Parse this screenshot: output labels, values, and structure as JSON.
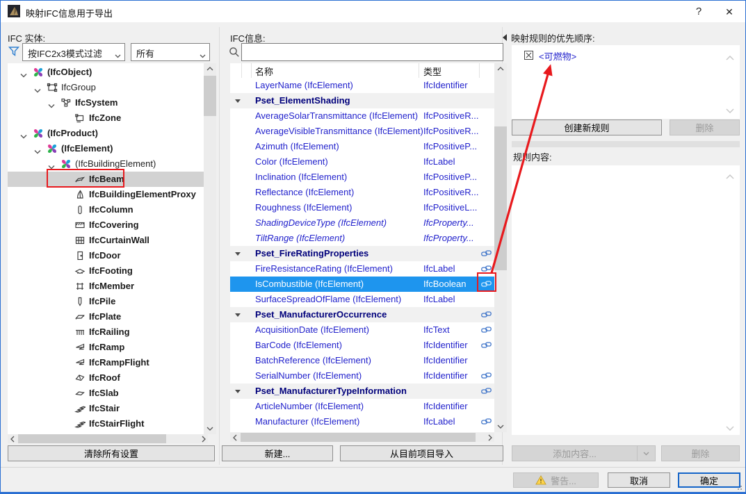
{
  "window": {
    "title": "映射IFC信息用于导出",
    "help": "?",
    "close": "✕"
  },
  "left_panel": {
    "label": "IFC 实体:",
    "filter_scheme": "按IFC2x3模式过滤",
    "filter_scope": "所有",
    "clear_button": "清除所有设置",
    "tree": [
      {
        "label": "(IfcObject)",
        "level": 0,
        "bold": true,
        "chevron": true,
        "icon": "pinwheel"
      },
      {
        "label": "IfcGroup",
        "level": 1,
        "bold": false,
        "chevron": true,
        "icon": "group"
      },
      {
        "label": "IfcSystem",
        "level": 2,
        "bold": true,
        "chevron": true,
        "icon": "system"
      },
      {
        "label": "IfcZone",
        "level": 3,
        "bold": true,
        "chevron": false,
        "icon": "zone"
      },
      {
        "label": "(IfcProduct)",
        "level": 0,
        "bold": true,
        "chevron": true,
        "icon": "pinwheel"
      },
      {
        "label": "(IfcElement)",
        "level": 1,
        "bold": true,
        "chevron": true,
        "icon": "pinwheel"
      },
      {
        "label": "(IfcBuildingElement)",
        "level": 2,
        "bold": false,
        "chevron": true,
        "icon": "pinwheel"
      },
      {
        "label": "IfcBeam",
        "level": 3,
        "bold": true,
        "chevron": false,
        "icon": "beam",
        "selected": true,
        "red_box": true
      },
      {
        "label": "IfcBuildingElementProxy",
        "level": 3,
        "bold": true,
        "chevron": false,
        "icon": "proxy"
      },
      {
        "label": "IfcColumn",
        "level": 3,
        "bold": true,
        "chevron": false,
        "icon": "column"
      },
      {
        "label": "IfcCovering",
        "level": 3,
        "bold": true,
        "chevron": false,
        "icon": "covering"
      },
      {
        "label": "IfcCurtainWall",
        "level": 3,
        "bold": true,
        "chevron": false,
        "icon": "curtainwall"
      },
      {
        "label": "IfcDoor",
        "level": 3,
        "bold": true,
        "chevron": false,
        "icon": "door"
      },
      {
        "label": "IfcFooting",
        "level": 3,
        "bold": true,
        "chevron": false,
        "icon": "footing"
      },
      {
        "label": "IfcMember",
        "level": 3,
        "bold": true,
        "chevron": false,
        "icon": "member"
      },
      {
        "label": "IfcPile",
        "level": 3,
        "bold": true,
        "chevron": false,
        "icon": "pile"
      },
      {
        "label": "IfcPlate",
        "level": 3,
        "bold": true,
        "chevron": false,
        "icon": "plate"
      },
      {
        "label": "IfcRailing",
        "level": 3,
        "bold": true,
        "chevron": false,
        "icon": "railing"
      },
      {
        "label": "IfcRamp",
        "level": 3,
        "bold": true,
        "chevron": false,
        "icon": "ramp"
      },
      {
        "label": "IfcRampFlight",
        "level": 3,
        "bold": true,
        "chevron": false,
        "icon": "ramp"
      },
      {
        "label": "IfcRoof",
        "level": 3,
        "bold": true,
        "chevron": false,
        "icon": "roof"
      },
      {
        "label": "IfcSlab",
        "level": 3,
        "bold": true,
        "chevron": false,
        "icon": "slab"
      },
      {
        "label": "IfcStair",
        "level": 3,
        "bold": true,
        "chevron": false,
        "icon": "stair"
      },
      {
        "label": "IfcStairFlight",
        "level": 3,
        "bold": true,
        "chevron": false,
        "icon": "stair"
      }
    ]
  },
  "middle_panel": {
    "label": "IFC信息:",
    "search_value": "",
    "columns": {
      "name": "名称",
      "type": "类型"
    },
    "rows": [
      {
        "kind": "property",
        "name": "LayerName (IfcElement)",
        "type": "IfcIdentifier"
      },
      {
        "kind": "group",
        "name": "Pset_ElementShading"
      },
      {
        "kind": "property",
        "name": "AverageSolarTransmittance (IfcElement)",
        "type": "IfcPositiveR..."
      },
      {
        "kind": "property",
        "name": "AverageVisibleTransmittance (IfcElement)",
        "type": "IfcPositiveR..."
      },
      {
        "kind": "property",
        "name": "Azimuth (IfcElement)",
        "type": "IfcPositiveP..."
      },
      {
        "kind": "property",
        "name": "Color (IfcElement)",
        "type": "IfcLabel"
      },
      {
        "kind": "property",
        "name": "Inclination (IfcElement)",
        "type": "IfcPositiveP..."
      },
      {
        "kind": "property",
        "name": "Reflectance (IfcElement)",
        "type": "IfcPositiveR..."
      },
      {
        "kind": "property",
        "name": "Roughness (IfcElement)",
        "type": "IfcPositiveL..."
      },
      {
        "kind": "property",
        "name": "ShadingDeviceType (IfcElement)",
        "type": "IfcProperty...",
        "italic": true
      },
      {
        "kind": "property",
        "name": "TiltRange (IfcElement)",
        "type": "IfcProperty...",
        "italic": true
      },
      {
        "kind": "group",
        "name": "Pset_FireRatingProperties",
        "link": true
      },
      {
        "kind": "property",
        "name": "FireResistanceRating (IfcElement)",
        "type": "IfcLabel",
        "link": true
      },
      {
        "kind": "property",
        "name": "IsCombustible (IfcElement)",
        "type": "IfcBoolean",
        "link": true,
        "selected": true,
        "red_box": true
      },
      {
        "kind": "property",
        "name": "SurfaceSpreadOfFlame (IfcElement)",
        "type": "IfcLabel"
      },
      {
        "kind": "group",
        "name": "Pset_ManufacturerOccurrence",
        "link": true
      },
      {
        "kind": "property",
        "name": "AcquisitionDate (IfcElement)",
        "type": "IfcText",
        "link": true
      },
      {
        "kind": "property",
        "name": "BarCode (IfcElement)",
        "type": "IfcIdentifier",
        "link": true
      },
      {
        "kind": "property",
        "name": "BatchReference (IfcElement)",
        "type": "IfcIdentifier"
      },
      {
        "kind": "property",
        "name": "SerialNumber (IfcElement)",
        "type": "IfcIdentifier",
        "link": true
      },
      {
        "kind": "group",
        "name": "Pset_ManufacturerTypeInformation",
        "link": true
      },
      {
        "kind": "property",
        "name": "ArticleNumber (IfcElement)",
        "type": "IfcIdentifier"
      },
      {
        "kind": "property",
        "name": "Manufacturer (IfcElement)",
        "type": "IfcLabel",
        "link": true
      }
    ],
    "new_button": "新建...",
    "import_button": "从目前项目导入"
  },
  "right_panel": {
    "priority_label": "映射规则的优先顺序:",
    "rule_items": [
      {
        "label": "<可燃物>"
      }
    ],
    "create_rule_button": "创建新规则",
    "delete_button": "删除",
    "content_label": "规则内容:",
    "add_content_button": "添加内容...",
    "delete_content_button": "删除"
  },
  "footer": {
    "warning_button": "警告...",
    "cancel_button": "取消",
    "ok_button": "确定"
  },
  "colors": {
    "selection_blue": "#1e95ee",
    "property_text": "#2222cc",
    "pset_text": "#00007b",
    "annotation_red": "#e8191d",
    "window_border": "#2a6fd2",
    "ok_border": "#1464c8"
  }
}
